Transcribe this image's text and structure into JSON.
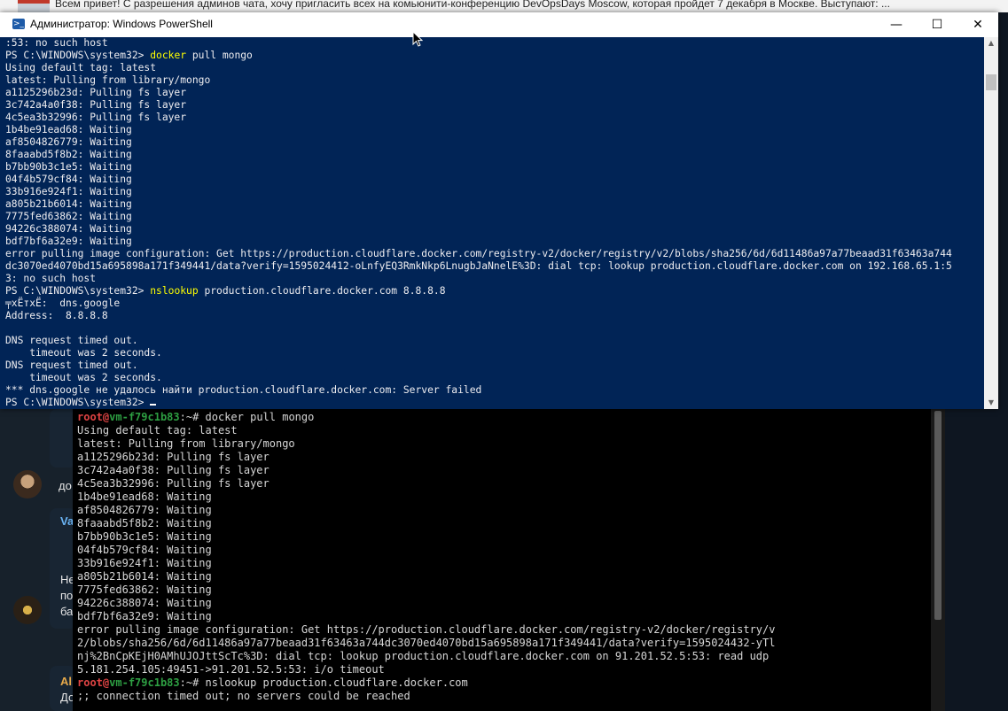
{
  "notification": {
    "text": "Всем привет!  С разрешения админов чата, хочу пригласить всех на комьюнити-конференцию DevOpsDays Moscow, которая пройдет 7 декабря в Москве.   Выступают: ..."
  },
  "chat": {
    "snippets": [
      "до",
      "Va",
      "Не",
      "по",
      "ба",
      "Al",
      "До"
    ]
  },
  "powershell": {
    "title": "Администратор: Windows PowerShell",
    "minimize": "—",
    "maximize": "☐",
    "close": "✕",
    "lines": [
      {
        "text": ":53: no such host"
      },
      {
        "prompt": "PS C:\\WINDOWS\\system32> ",
        "cmd": "docker",
        "rest": " pull mongo"
      },
      {
        "text": "Using default tag: latest"
      },
      {
        "text": "latest: Pulling from library/mongo"
      },
      {
        "text": "a1125296b23d: Pulling fs layer"
      },
      {
        "text": "3c742a4a0f38: Pulling fs layer"
      },
      {
        "text": "4c5ea3b32996: Pulling fs layer"
      },
      {
        "text": "1b4be91ead68: Waiting"
      },
      {
        "text": "af8504826779: Waiting"
      },
      {
        "text": "8faaabd5f8b2: Waiting"
      },
      {
        "text": "b7bb90b3c1e5: Waiting"
      },
      {
        "text": "04f4b579cf84: Waiting"
      },
      {
        "text": "33b916e924f1: Waiting"
      },
      {
        "text": "a805b21b6014: Waiting"
      },
      {
        "text": "7775fed63862: Waiting"
      },
      {
        "text": "94226c388074: Waiting"
      },
      {
        "text": "bdf7bf6a32e9: Waiting"
      },
      {
        "text": "error pulling image configuration: Get https://production.cloudflare.docker.com/registry-v2/docker/registry/v2/blobs/sha256/6d/6d11486a97a77beaad31f63463a744"
      },
      {
        "text": "dc3070ed4070bd15a695898a171f349441/data?verify=1595024412-oLnfyEQ3RmkNkp6LnugbJaNnelE%3D: dial tcp: lookup production.cloudflare.docker.com on 192.168.65.1:5"
      },
      {
        "text": "3: no such host"
      },
      {
        "prompt": "PS C:\\WINDOWS\\system32> ",
        "cmd": "nslookup",
        "rest": " production.cloudflare.docker.com 8.8.8.8"
      },
      {
        "text": "╤хЁтхЁ:  dns.google"
      },
      {
        "text": "Address:  8.8.8.8"
      },
      {
        "text": ""
      },
      {
        "text": "DNS request timed out."
      },
      {
        "text": "    timeout was 2 seconds."
      },
      {
        "text": "DNS request timed out."
      },
      {
        "text": "    timeout was 2 seconds."
      },
      {
        "text": "*** dns.google не удалось найти production.cloudflare.docker.com: Server failed"
      },
      {
        "prompt": "PS C:\\WINDOWS\\system32> ",
        "cursor": true
      }
    ]
  },
  "linux": {
    "user": "root",
    "at": "@",
    "host": "vm-f79c1b83",
    "sep": ":~# ",
    "lines": [
      {
        "prompt": true,
        "rest": "docker pull mongo"
      },
      {
        "text": "Using default tag: latest"
      },
      {
        "text": "latest: Pulling from library/mongo"
      },
      {
        "text": "a1125296b23d: Pulling fs layer"
      },
      {
        "text": "3c742a4a0f38: Pulling fs layer"
      },
      {
        "text": "4c5ea3b32996: Pulling fs layer"
      },
      {
        "text": "1b4be91ead68: Waiting"
      },
      {
        "text": "af8504826779: Waiting"
      },
      {
        "text": "8faaabd5f8b2: Waiting"
      },
      {
        "text": "b7bb90b3c1e5: Waiting"
      },
      {
        "text": "04f4b579cf84: Waiting"
      },
      {
        "text": "33b916e924f1: Waiting"
      },
      {
        "text": "a805b21b6014: Waiting"
      },
      {
        "text": "7775fed63862: Waiting"
      },
      {
        "text": "94226c388074: Waiting"
      },
      {
        "text": "bdf7bf6a32e9: Waiting"
      },
      {
        "text": "error pulling image configuration: Get https://production.cloudflare.docker.com/registry-v2/docker/registry/v"
      },
      {
        "text": "2/blobs/sha256/6d/6d11486a97a77beaad31f63463a744dc3070ed4070bd15a695898a171f349441/data?verify=1595024432-yTl"
      },
      {
        "text": "nj%2BnCpKEjH0AMhUJOJttScTc%3D: dial tcp: lookup production.cloudflare.docker.com on 91.201.52.5:53: read udp"
      },
      {
        "text": "5.181.254.105:49451->91.201.52.5:53: i/o timeout"
      },
      {
        "prompt": true,
        "rest": "nslookup production.cloudflare.docker.com"
      },
      {
        "text": ";; connection timed out; no servers could be reached"
      }
    ]
  }
}
